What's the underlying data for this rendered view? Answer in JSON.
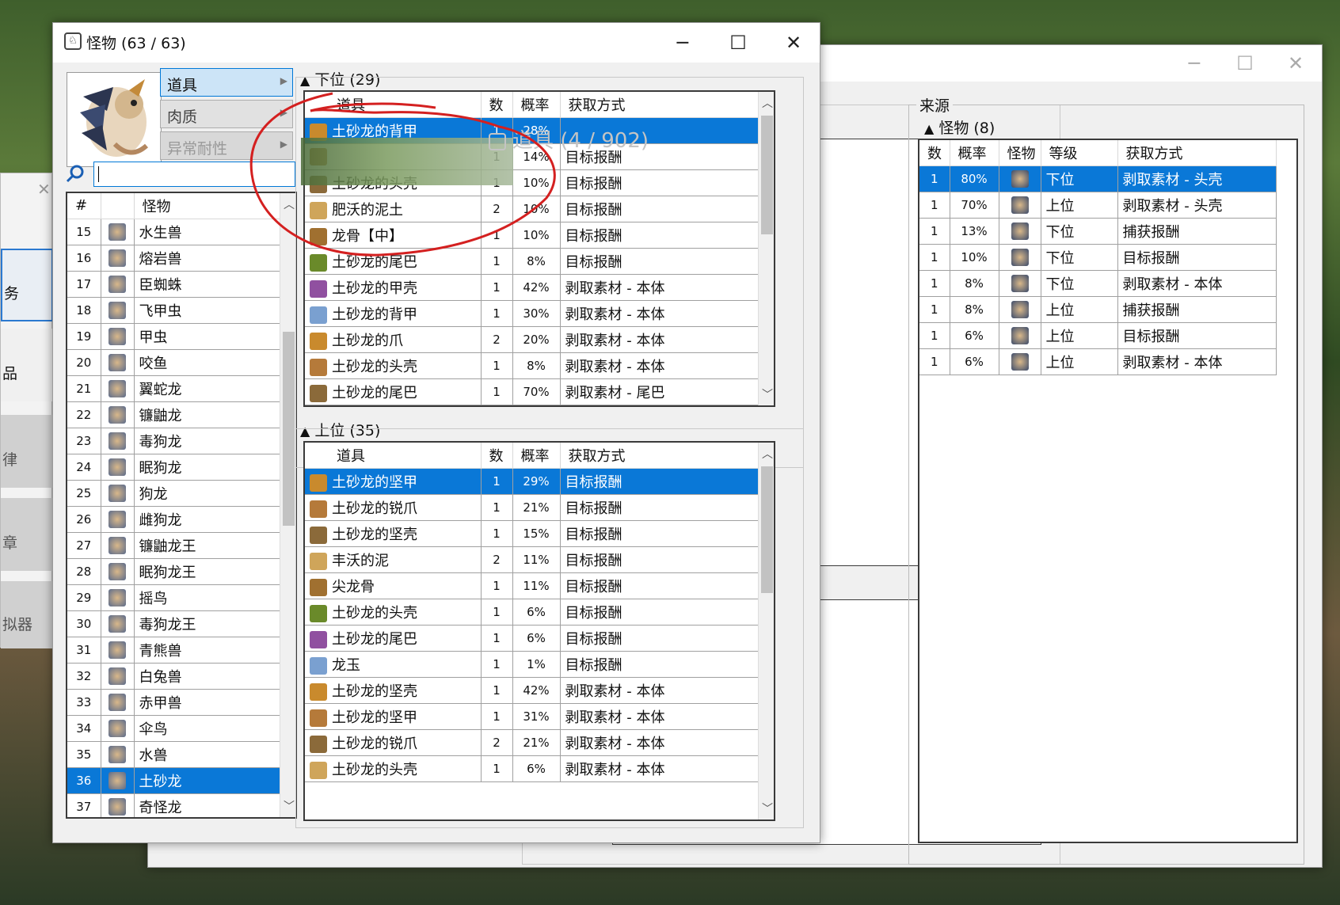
{
  "main_window": {
    "title": "怪物 (63 / 63)",
    "min": "─",
    "max": "☐",
    "close": "✕"
  },
  "menu": [
    {
      "label": "道具",
      "state": "active"
    },
    {
      "label": "肉质",
      "state": "normal"
    },
    {
      "label": "异常耐性",
      "state": "disabled"
    }
  ],
  "search": {
    "value": ""
  },
  "monster_list": {
    "headers": [
      "#",
      "怪物"
    ],
    "rows": [
      {
        "n": "15",
        "name": "水生兽"
      },
      {
        "n": "16",
        "name": "熔岩兽"
      },
      {
        "n": "17",
        "name": "臣蜘蛛"
      },
      {
        "n": "18",
        "name": "飞甲虫"
      },
      {
        "n": "19",
        "name": "甲虫"
      },
      {
        "n": "20",
        "name": "咬鱼"
      },
      {
        "n": "21",
        "name": "翼蛇龙"
      },
      {
        "n": "22",
        "name": "镰鼬龙"
      },
      {
        "n": "23",
        "name": "毒狗龙"
      },
      {
        "n": "24",
        "name": "眠狗龙"
      },
      {
        "n": "25",
        "name": "狗龙"
      },
      {
        "n": "26",
        "name": "雌狗龙"
      },
      {
        "n": "27",
        "name": "镰鼬龙王"
      },
      {
        "n": "28",
        "name": "眠狗龙王"
      },
      {
        "n": "29",
        "name": "摇鸟"
      },
      {
        "n": "30",
        "name": "毒狗龙王"
      },
      {
        "n": "31",
        "name": "青熊兽"
      },
      {
        "n": "32",
        "name": "白兔兽"
      },
      {
        "n": "33",
        "name": "赤甲兽"
      },
      {
        "n": "34",
        "name": "伞鸟"
      },
      {
        "n": "35",
        "name": "水兽"
      },
      {
        "n": "36",
        "name": "土砂龙",
        "selected": true
      },
      {
        "n": "37",
        "name": "奇怪龙"
      }
    ]
  },
  "low_rank": {
    "label": "下位 (29)",
    "headers": [
      "道具",
      "数",
      "概率",
      "获取方式"
    ],
    "rows": [
      {
        "item": "土砂龙的背甲",
        "num": "1",
        "rate": "28%",
        "method": "",
        "selected": true
      },
      {
        "item": "",
        "num": "1",
        "rate": "14%",
        "method": "目标报酬"
      },
      {
        "item": "土砂龙的头壳",
        "num": "1",
        "rate": "10%",
        "method": "目标报酬"
      },
      {
        "item": "肥沃的泥土",
        "num": "2",
        "rate": "10%",
        "method": "目标报酬"
      },
      {
        "item": "龙骨【中】",
        "num": "1",
        "rate": "10%",
        "method": "目标报酬"
      },
      {
        "item": "土砂龙的尾巴",
        "num": "1",
        "rate": "8%",
        "method": "目标报酬"
      },
      {
        "item": "土砂龙的甲壳",
        "num": "1",
        "rate": "42%",
        "method": "剥取素材 - 本体"
      },
      {
        "item": "土砂龙的背甲",
        "num": "1",
        "rate": "30%",
        "method": "剥取素材 - 本体"
      },
      {
        "item": "土砂龙的爪",
        "num": "2",
        "rate": "20%",
        "method": "剥取素材 - 本体"
      },
      {
        "item": "土砂龙的头壳",
        "num": "1",
        "rate": "8%",
        "method": "剥取素材 - 本体"
      },
      {
        "item": "土砂龙的尾巴",
        "num": "1",
        "rate": "70%",
        "method": "剥取素材 - 尾巴"
      }
    ]
  },
  "high_rank": {
    "label": "上位 (35)",
    "headers": [
      "道具",
      "数",
      "概率",
      "获取方式"
    ],
    "rows": [
      {
        "item": "土砂龙的坚甲",
        "num": "1",
        "rate": "29%",
        "method": "目标报酬",
        "selected": true
      },
      {
        "item": "土砂龙的锐爪",
        "num": "1",
        "rate": "21%",
        "method": "目标报酬"
      },
      {
        "item": "土砂龙的坚壳",
        "num": "1",
        "rate": "15%",
        "method": "目标报酬"
      },
      {
        "item": "丰沃的泥",
        "num": "2",
        "rate": "11%",
        "method": "目标报酬"
      },
      {
        "item": "尖龙骨",
        "num": "1",
        "rate": "11%",
        "method": "目标报酬"
      },
      {
        "item": "土砂龙的头壳",
        "num": "1",
        "rate": "6%",
        "method": "目标报酬"
      },
      {
        "item": "土砂龙的尾巴",
        "num": "1",
        "rate": "6%",
        "method": "目标报酬"
      },
      {
        "item": "龙玉",
        "num": "1",
        "rate": "1%",
        "method": "目标报酬"
      },
      {
        "item": "土砂龙的坚壳",
        "num": "1",
        "rate": "42%",
        "method": "剥取素材 - 本体"
      },
      {
        "item": "土砂龙的坚甲",
        "num": "1",
        "rate": "31%",
        "method": "剥取素材 - 本体"
      },
      {
        "item": "土砂龙的锐爪",
        "num": "2",
        "rate": "21%",
        "method": "剥取素材 - 本体"
      },
      {
        "item": "土砂龙的头壳",
        "num": "1",
        "rate": "6%",
        "method": "剥取素材 - 本体"
      }
    ]
  },
  "overlay_ghost": "道具 (4 / 902)",
  "back_window": {
    "source_label": "来源",
    "monster_group": "怪物 (8)",
    "headers": [
      "数",
      "概率",
      "怪物",
      "等级",
      "获取方式"
    ],
    "rows": [
      {
        "num": "1",
        "rate": "80%",
        "rank": "下位",
        "method": "剥取素材 - 头壳",
        "selected": true
      },
      {
        "num": "1",
        "rate": "70%",
        "rank": "上位",
        "method": "剥取素材 - 头壳"
      },
      {
        "num": "1",
        "rate": "13%",
        "rank": "下位",
        "method": "捕获报酬"
      },
      {
        "num": "1",
        "rate": "10%",
        "rank": "下位",
        "method": "目标报酬"
      },
      {
        "num": "1",
        "rate": "8%",
        "rank": "下位",
        "method": "剥取素材 - 本体"
      },
      {
        "num": "1",
        "rate": "8%",
        "rank": "上位",
        "method": "捕获报酬"
      },
      {
        "num": "1",
        "rate": "6%",
        "rank": "上位",
        "method": "目标报酬"
      },
      {
        "num": "1",
        "rate": "6%",
        "rank": "上位",
        "method": "剥取素材 - 本体"
      }
    ]
  },
  "left_window": {
    "items": [
      "务",
      "品",
      "律",
      "章",
      "拟器"
    ]
  },
  "colors": {
    "selection": "#0a78d7",
    "annotation": "#d42020"
  }
}
